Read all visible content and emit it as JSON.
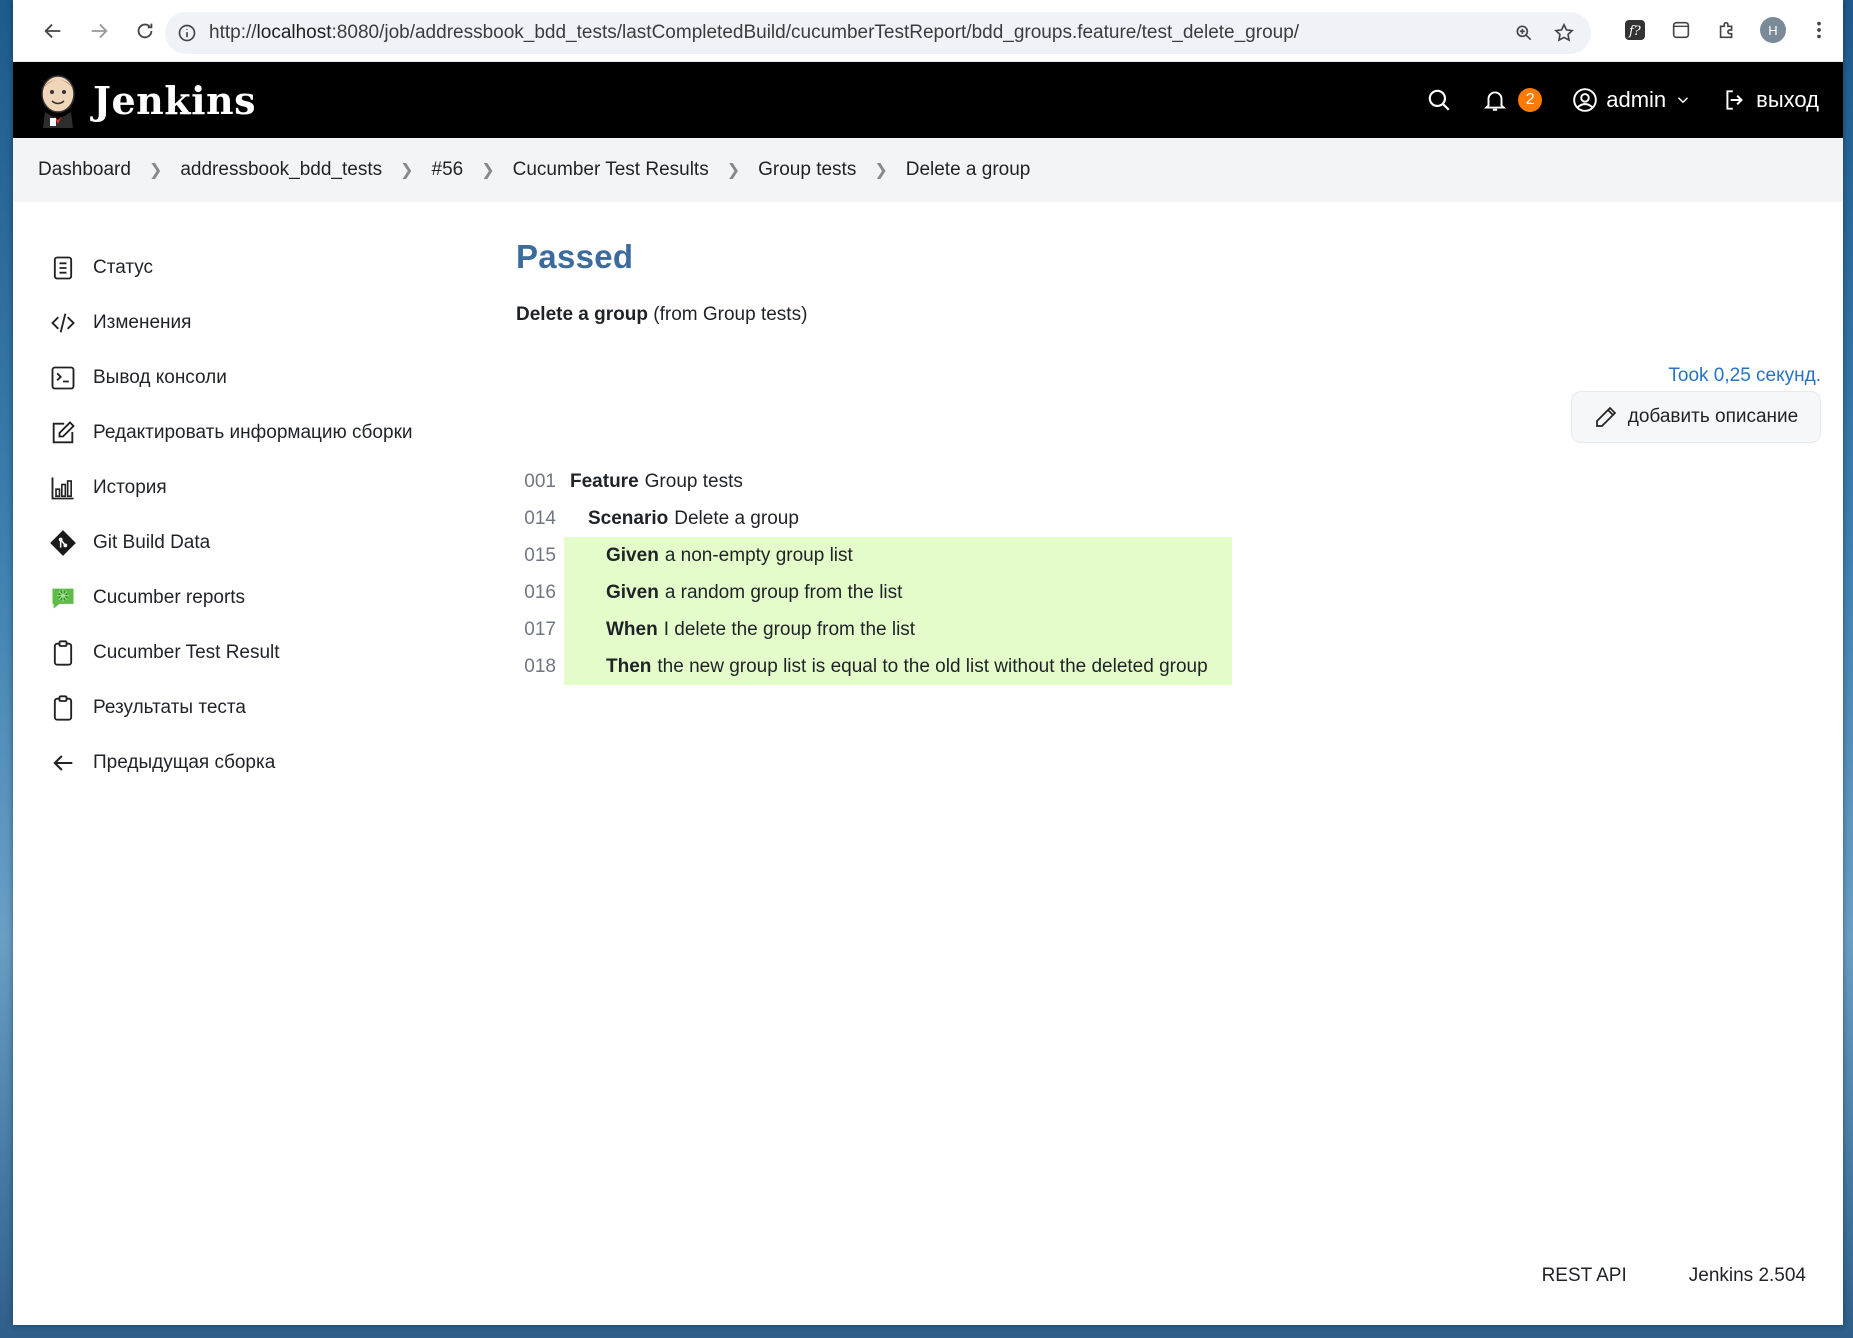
{
  "browser": {
    "url_prefix": "http://",
    "url_host": "localhost",
    "url_rest": ":8080/job/addressbook_bdd_tests/lastCompletedBuild/cucumberTestReport/bdd_groups.feature/test_delete_group/",
    "profile_initial": "H"
  },
  "header": {
    "brand": "Jenkins",
    "notification_count": "2",
    "user": "admin",
    "logout": "выход"
  },
  "breadcrumb": [
    "Dashboard",
    "addressbook_bdd_tests",
    "#56",
    "Cucumber Test Results",
    "Group tests",
    "Delete a group"
  ],
  "sidebar": {
    "items": [
      {
        "label": "Статус",
        "icon": "status-icon"
      },
      {
        "label": "Изменения",
        "icon": "code-icon"
      },
      {
        "label": "Вывод консоли",
        "icon": "terminal-icon"
      },
      {
        "label": "Редактировать информацию сборки",
        "icon": "edit-icon"
      },
      {
        "label": "История",
        "icon": "history-chart-icon"
      },
      {
        "label": "Git Build Data",
        "icon": "git-icon"
      },
      {
        "label": "Cucumber reports",
        "icon": "cucumber-icon"
      },
      {
        "label": "Cucumber Test Result",
        "icon": "clipboard-icon"
      },
      {
        "label": "Результаты теста",
        "icon": "clipboard-icon"
      },
      {
        "label": "Предыдущая сборка",
        "icon": "arrow-left-icon"
      }
    ]
  },
  "main": {
    "status": "Passed",
    "test_name": "Delete a group",
    "test_from": "(from Group tests)",
    "took": "Took 0,25 секунд.",
    "add_description": "добавить описание",
    "gherkin": [
      {
        "num": "001",
        "keyword": "Feature",
        "text": "Group tests",
        "indent": 0,
        "passed": false
      },
      {
        "num": "014",
        "keyword": "Scenario",
        "text": "Delete a group",
        "indent": 1,
        "passed": false
      },
      {
        "num": "015",
        "keyword": "Given",
        "text": "a non-empty group list",
        "indent": 2,
        "passed": true
      },
      {
        "num": "016",
        "keyword": "Given",
        "text": "a random group from the list",
        "indent": 2,
        "passed": true
      },
      {
        "num": "017",
        "keyword": "When",
        "text": "I delete the group from the list",
        "indent": 2,
        "passed": true
      },
      {
        "num": "018",
        "keyword": "Then",
        "text": "the new group list is equal to the old list without the deleted group",
        "indent": 2,
        "passed": true
      }
    ]
  },
  "footer": {
    "rest_api": "REST API",
    "version": "Jenkins 2.504"
  },
  "colors": {
    "header_bg": "#000000",
    "status_title": "#3b6c9d",
    "passed_bg": "#e3fcc9",
    "link": "#2673c4",
    "badge": "#ff7a00"
  }
}
